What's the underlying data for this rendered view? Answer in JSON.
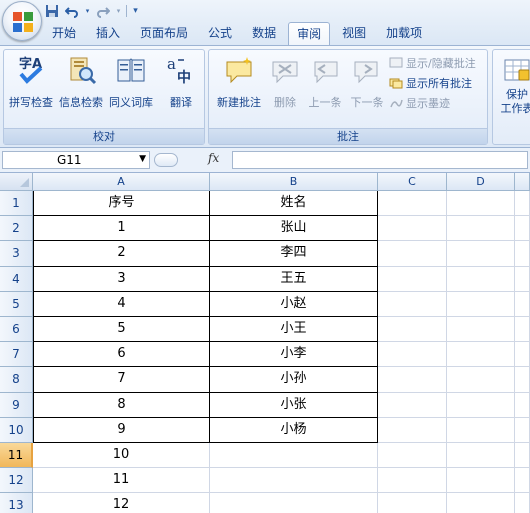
{
  "quick_access": {
    "undo_icon": "undo-icon",
    "redo_icon": "redo-icon",
    "save_icon": "save-icon"
  },
  "tabs": [
    {
      "label": "开始"
    },
    {
      "label": "插入"
    },
    {
      "label": "页面布局"
    },
    {
      "label": "公式"
    },
    {
      "label": "数据"
    },
    {
      "label": "审阅",
      "active": true
    },
    {
      "label": "视图"
    },
    {
      "label": "加载项"
    }
  ],
  "ribbon": {
    "proofing": {
      "label": "校对",
      "buttons": [
        {
          "label": "拼写检查",
          "icon": "spellcheck-icon"
        },
        {
          "label": "信息检索",
          "icon": "research-icon"
        },
        {
          "label": "同义词库",
          "icon": "thesaurus-icon"
        },
        {
          "label": "翻译",
          "icon": "translate-icon"
        }
      ]
    },
    "comments": {
      "label": "批注",
      "buttons": [
        {
          "label": "新建批注",
          "icon": "new-comment-icon",
          "enabled": true
        },
        {
          "label": "删除",
          "icon": "delete-comment-icon",
          "enabled": false
        },
        {
          "label": "上一条",
          "icon": "previous-comment-icon",
          "enabled": false
        },
        {
          "label": "下一条",
          "icon": "next-comment-icon",
          "enabled": false
        }
      ],
      "small": [
        {
          "label": "显示/隐藏批注",
          "enabled": false
        },
        {
          "label": "显示所有批注",
          "enabled": true
        },
        {
          "label": "显示墨迹",
          "enabled": false
        }
      ]
    },
    "protect": {
      "line1": "保护",
      "line2": "工作表"
    }
  },
  "formula_bar": {
    "name_box": "G11",
    "fx": "fx",
    "value": ""
  },
  "sheet": {
    "columns": [
      "A",
      "B",
      "C",
      "D"
    ],
    "selected_row": 11,
    "rows": [
      {
        "n": "1",
        "a": "序号",
        "b": "姓名"
      },
      {
        "n": "2",
        "a": "1",
        "b": "张山"
      },
      {
        "n": "3",
        "a": "2",
        "b": "李四"
      },
      {
        "n": "4",
        "a": "3",
        "b": "王五"
      },
      {
        "n": "5",
        "a": "4",
        "b": "小赵"
      },
      {
        "n": "6",
        "a": "5",
        "b": "小王"
      },
      {
        "n": "7",
        "a": "6",
        "b": "小李"
      },
      {
        "n": "8",
        "a": "7",
        "b": "小孙"
      },
      {
        "n": "9",
        "a": "8",
        "b": "小张"
      },
      {
        "n": "10",
        "a": "9",
        "b": "小杨"
      },
      {
        "n": "11",
        "a": "10",
        "b": ""
      },
      {
        "n": "12",
        "a": "11",
        "b": ""
      },
      {
        "n": "13",
        "a": "12",
        "b": ""
      }
    ]
  }
}
